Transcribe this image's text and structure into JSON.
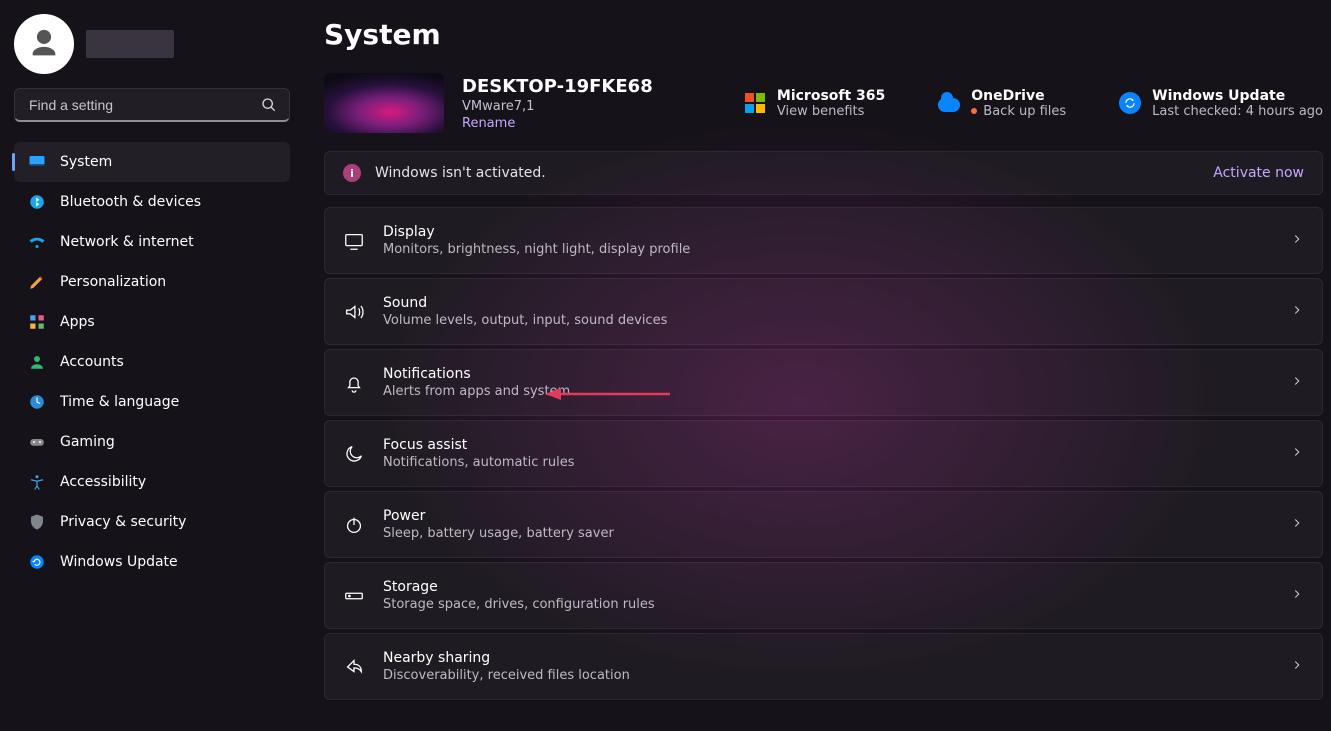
{
  "user": {
    "name": ""
  },
  "search": {
    "placeholder": "Find a setting"
  },
  "sidebar": {
    "items": [
      {
        "label": "System",
        "icon": "system-icon",
        "active": true
      },
      {
        "label": "Bluetooth & devices",
        "icon": "bluetooth-icon"
      },
      {
        "label": "Network & internet",
        "icon": "wifi-icon"
      },
      {
        "label": "Personalization",
        "icon": "personalization-icon"
      },
      {
        "label": "Apps",
        "icon": "apps-icon"
      },
      {
        "label": "Accounts",
        "icon": "accounts-icon"
      },
      {
        "label": "Time & language",
        "icon": "time-language-icon"
      },
      {
        "label": "Gaming",
        "icon": "gaming-icon"
      },
      {
        "label": "Accessibility",
        "icon": "accessibility-icon"
      },
      {
        "label": "Privacy & security",
        "icon": "privacy-icon"
      },
      {
        "label": "Windows Update",
        "icon": "windows-update-icon"
      }
    ]
  },
  "page": {
    "title": "System",
    "device": {
      "name": "DESKTOP-19FKE68",
      "model": "VMware7,1",
      "rename_label": "Rename"
    },
    "header_links": {
      "ms365": {
        "title": "Microsoft 365",
        "subtitle": "View benefits"
      },
      "onedrive": {
        "title": "OneDrive",
        "subtitle": "Back up files"
      },
      "windows_update": {
        "title": "Windows Update",
        "subtitle": "Last checked: 4 hours ago"
      }
    },
    "activation_banner": {
      "message": "Windows isn't activated.",
      "action": "Activate now"
    },
    "settings": [
      {
        "title": "Display",
        "subtitle": "Monitors, brightness, night light, display profile",
        "icon": "display-icon"
      },
      {
        "title": "Sound",
        "subtitle": "Volume levels, output, input, sound devices",
        "icon": "sound-icon"
      },
      {
        "title": "Notifications",
        "subtitle": "Alerts from apps and system",
        "icon": "bell-icon"
      },
      {
        "title": "Focus assist",
        "subtitle": "Notifications, automatic rules",
        "icon": "moon-icon"
      },
      {
        "title": "Power",
        "subtitle": "Sleep, battery usage, battery saver",
        "icon": "power-icon"
      },
      {
        "title": "Storage",
        "subtitle": "Storage space, drives, configuration rules",
        "icon": "storage-icon"
      },
      {
        "title": "Nearby sharing",
        "subtitle": "Discoverability, received files location",
        "icon": "share-icon"
      }
    ],
    "annotation": {
      "target": "Notifications",
      "type": "arrow",
      "color": "#e23b5a"
    }
  }
}
